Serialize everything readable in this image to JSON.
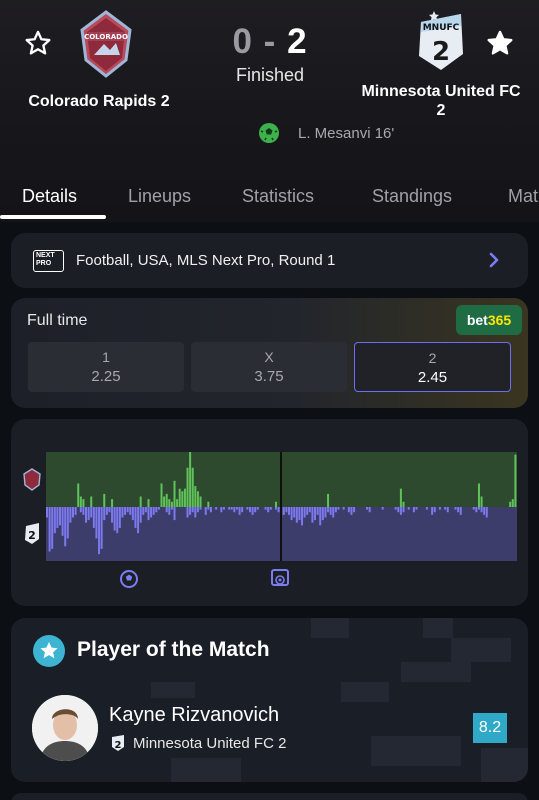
{
  "match": {
    "home": {
      "name": "Colorado Rapids 2",
      "logo_text": "COLORADO"
    },
    "away": {
      "name_line1": "Minnesota United FC",
      "name_line2": "2",
      "logo_text": "MNUFC",
      "logo_num": "2"
    },
    "score_home": "0",
    "score_sep": "-",
    "score_away": "2",
    "status": "Finished",
    "scorer": "L. Mesanvi 16'"
  },
  "tabs": [
    "Details",
    "Lineups",
    "Statistics",
    "Standings",
    "Mat"
  ],
  "league": {
    "text": "Football, USA, MLS Next Pro, Round 1",
    "logo_text_1": "NEXT",
    "logo_text_2": "PRO"
  },
  "odds": {
    "title": "Full time",
    "bookmaker_part1": "bet",
    "bookmaker_part2": "365",
    "options": [
      {
        "label": "1",
        "value": "2.25"
      },
      {
        "label": "X",
        "value": "3.75"
      },
      {
        "label": "2",
        "value": "2.45"
      }
    ]
  },
  "chart_data": {
    "type": "bar",
    "series": [
      {
        "values": [
          0,
          0,
          0,
          0,
          0,
          0,
          0,
          0,
          0,
          0,
          0,
          0,
          9,
          4,
          3,
          0,
          0,
          4,
          0,
          0,
          0,
          0,
          5,
          0,
          0,
          3,
          0,
          0,
          0,
          0,
          0,
          0,
          0,
          0,
          0,
          0,
          4,
          0,
          0,
          3,
          0,
          0,
          0,
          0,
          9,
          4,
          5,
          3,
          2,
          10,
          3,
          7,
          6,
          7,
          15,
          21,
          15,
          8,
          6,
          4,
          0,
          0,
          2,
          0,
          0,
          0,
          0,
          0,
          0,
          0,
          0,
          0,
          0,
          0,
          0,
          0,
          0,
          0,
          0,
          0,
          0,
          0,
          0,
          0,
          0,
          0,
          0,
          0,
          2,
          0,
          0,
          0,
          0,
          0,
          0,
          0,
          0,
          0,
          0,
          0,
          0,
          0,
          0,
          0,
          0,
          0,
          0,
          0,
          5,
          0,
          0,
          0,
          0,
          0,
          0,
          0,
          0,
          0,
          0,
          0,
          0,
          0,
          0,
          0,
          0,
          0,
          0,
          0,
          0,
          0,
          0,
          0,
          0,
          0,
          0,
          0,
          7,
          2,
          0,
          0,
          0,
          0,
          0,
          0,
          0,
          0,
          0,
          0,
          0,
          0,
          0,
          0,
          0,
          0,
          0,
          0,
          0,
          0,
          0,
          0,
          0,
          0,
          0,
          0,
          0,
          0,
          9,
          4,
          0,
          0,
          0,
          0,
          0,
          0,
          0,
          0,
          0,
          0,
          2,
          3,
          20
        ]
      },
      {
        "values": [
          -4,
          -17,
          -16,
          -10,
          -8,
          -7,
          -11,
          -15,
          -12,
          -6,
          -4,
          -3,
          0,
          -2,
          -3,
          -6,
          -5,
          -4,
          -8,
          -12,
          -18,
          -16,
          -5,
          -3,
          -2,
          -6,
          -9,
          -10,
          -8,
          -4,
          -3,
          -2,
          -3,
          -5,
          -8,
          -10,
          -6,
          -3,
          -2,
          -5,
          -4,
          -3,
          -2,
          -1,
          0,
          0,
          -2,
          -3,
          -1,
          -5,
          0,
          0,
          0,
          0,
          -4,
          -3,
          -2,
          -4,
          -2,
          -1,
          0,
          -3,
          -1,
          -2,
          0,
          -1,
          0,
          -2,
          -1,
          0,
          -1,
          -1,
          -2,
          -1,
          -3,
          -2,
          0,
          -1,
          -2,
          -3,
          -2,
          -1,
          0,
          0,
          -1,
          -2,
          -1,
          0,
          -1,
          -2,
          -4,
          -3,
          -2,
          -3,
          -5,
          -4,
          -6,
          -5,
          -7,
          -4,
          -3,
          -2,
          -6,
          -5,
          -3,
          -7,
          -5,
          -4,
          -2,
          -3,
          -4,
          -2,
          -1,
          0,
          -1,
          0,
          -2,
          -3,
          -2,
          0,
          0,
          0,
          0,
          -1,
          -2,
          0,
          0,
          0,
          0,
          -1,
          0,
          0,
          0,
          0,
          -1,
          -2,
          -3,
          -2,
          0,
          -1,
          0,
          -2,
          -1,
          0,
          0,
          0,
          -1,
          0,
          -3,
          -2,
          0,
          -1,
          0,
          -1,
          -2,
          0,
          0,
          -1,
          -2,
          -3,
          0,
          0,
          0,
          0,
          -1,
          -2,
          -1,
          -2,
          -3,
          -4,
          0,
          0,
          0,
          0,
          0,
          0,
          0
        ]
      }
    ]
  },
  "potm": {
    "title": "Player of the Match",
    "player": "Kayne Rizvanovich",
    "team": "Minnesota United FC 2",
    "team_logo_num": "2",
    "rating": "8.2"
  },
  "colors": {
    "accent": "#6c6ff2",
    "home_bar": "#5fc35a",
    "away_bar": "#7c79ee",
    "rating": "#2fa9c7",
    "bet365": "#1f6b44"
  }
}
